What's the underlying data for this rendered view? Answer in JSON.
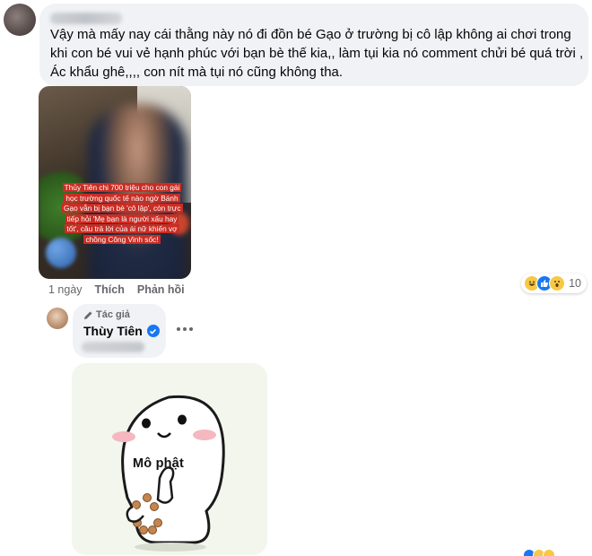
{
  "comment": {
    "text": "Vậy mà mấy nay cái thằng này nó đi đồn bé Gạo ở trường bị cô lập không ai chơi trong khi con bé vui vẻ hạnh phúc với bạn bè thế kia,, làm tụi kia nó comment chửi bé quá trời , Ác khẩu ghê,,,, con nít mà tụi nó cũng không tha.",
    "photo_caption": "Thủy Tiên chi 700 triệu cho con gái học trường quốc tế nào ngờ Bánh Gạo vẫn bị bạn bè 'cô lập', còn trực tiếp hỏi 'Mẹ bạn là người xấu hay tốt', câu trả lời của ái nữ khiến vợ chồng Công Vinh sốc!",
    "time": "1 ngày",
    "like_label": "Thích",
    "reply_label": "Phản hồi",
    "reactions": [
      "haha-icon",
      "like-icon",
      "wow-icon"
    ],
    "reaction_count": "10"
  },
  "reply": {
    "badge": "Tác giả",
    "author": "Thùy Tiên",
    "verified": true,
    "sticker_text": "Mô phật"
  },
  "colors": {
    "bubble": "#f0f2f5",
    "facebook_blue": "#1877f2",
    "secondary_text": "#65676b",
    "caption_bg": "#c92d24"
  }
}
